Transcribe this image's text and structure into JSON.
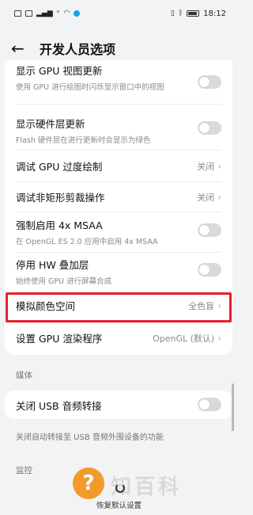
{
  "status_bar": {
    "left_icons": [
      "sim-icon",
      "sim-icon",
      "signal-icon",
      "volte-icon",
      "wifi-icon",
      "app-icon"
    ],
    "time": "18:12",
    "right_icons": [
      "vibrate-icon",
      "bluetooth-icon",
      "battery-icon"
    ]
  },
  "header": {
    "title": "开发人员选项"
  },
  "settings": [
    {
      "title": "显示 GPU 视图更新",
      "subtitle": "使用 GPU 进行绘图时闪烁显示窗口中的视图",
      "control": "toggle"
    },
    {
      "title": "显示硬件层更新",
      "subtitle": "Flash 硬件层在进行更新时会显示为绿色",
      "control": "toggle"
    },
    {
      "title": "调试 GPU 过度绘制",
      "value": "关闭",
      "control": "chevron"
    },
    {
      "title": "调试非矩形剪裁操作",
      "value": "关闭",
      "control": "chevron"
    },
    {
      "title": "强制启用 4x MSAA",
      "subtitle": "在 OpenGL ES 2.0 应用中启用 4x MSAA",
      "control": "toggle"
    },
    {
      "title": "停用 HW 叠加层",
      "subtitle": "始终使用 GPU 进行屏幕合成",
      "control": "toggle"
    },
    {
      "title": "模拟颜色空间",
      "value": "全色盲",
      "control": "chevron"
    },
    {
      "title": "设置 GPU 渲染程序",
      "value": "OpenGL (默认)",
      "control": "chevron"
    }
  ],
  "media_section": {
    "label": "媒体",
    "item": {
      "title": "关闭 USB 音频转接",
      "control": "toggle"
    },
    "footnote": "关闭自动转接至 USB 音频外围设备的功能"
  },
  "monitor_section": {
    "label": "监控"
  },
  "bottom": {
    "watermark_mark": "?",
    "watermark_text": "知百科",
    "restore_label": "恢复默认设置"
  },
  "colors": {
    "highlight": "#e8202a",
    "watermark": "#f39a2c"
  }
}
